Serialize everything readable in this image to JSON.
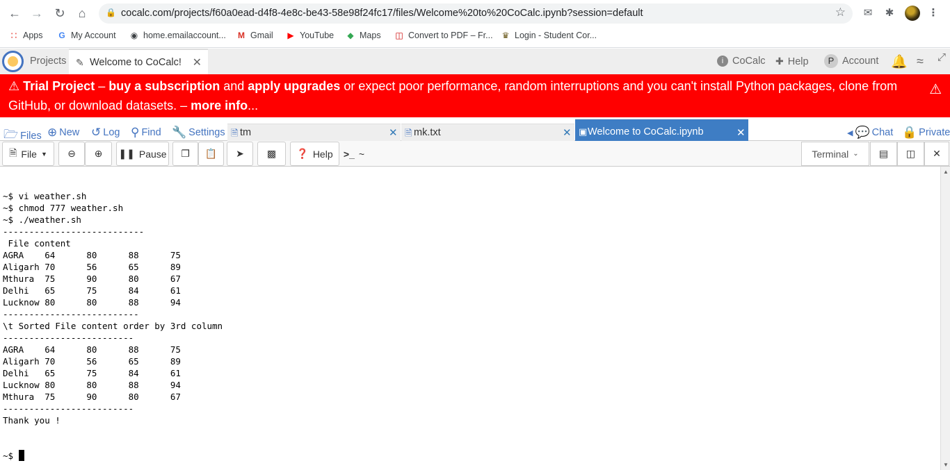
{
  "browser": {
    "url": "cocalc.com/projects/f60a0ead-d4f8-4e8c-be43-58e98f24fc17/files/Welcome%20to%20CoCalc.ipynb?session=default",
    "bookmarks": [
      {
        "label": "Apps",
        "icon": "apps-grid-icon"
      },
      {
        "label": "My Account",
        "icon": "google-icon"
      },
      {
        "label": "home.emailaccount...",
        "icon": "globe-icon"
      },
      {
        "label": "Gmail",
        "icon": "gmail-icon"
      },
      {
        "label": "YouTube",
        "icon": "youtube-icon"
      },
      {
        "label": "Maps",
        "icon": "maps-icon"
      },
      {
        "label": "Convert to PDF – Fr...",
        "icon": "pdf-icon"
      },
      {
        "label": "Login - Student Cor...",
        "icon": "student-icon"
      }
    ]
  },
  "cocalc_nav": {
    "projects": "Projects",
    "active_tab": "Welcome to CoCalc!",
    "cocalc": "CoCalc",
    "help": "Help",
    "account": "Account",
    "account_initial": "P"
  },
  "banner": {
    "part1": "Trial Project",
    "part2": " – ",
    "part3": "buy a subscription",
    "part4": " and ",
    "part5": "apply upgrades",
    "part6": " or expect poor performance, random interruptions and you can't install Python packages, clone from GitHub, or download datasets. – ",
    "part7": "more info",
    "part8": "..."
  },
  "file_tools": {
    "files": "Files",
    "new": "New",
    "log": "Log",
    "find": "Find",
    "settings": "Settings",
    "chat": "Chat",
    "private": "Private"
  },
  "file_tabs": [
    {
      "label": "tm",
      "active": false
    },
    {
      "label": "mk.txt",
      "active": false
    },
    {
      "label": "Welcome to CoCalc.ipynb",
      "active": true
    }
  ],
  "toolbar": {
    "file": "File",
    "pause": "Pause",
    "help": "Help",
    "term_prompt": "~",
    "terminal": "Terminal"
  },
  "terminal_lines": [
    "~$ vi weather.sh",
    "~$ chmod 777 weather.sh",
    "~$ ./weather.sh",
    "---------------------------",
    " File content",
    "AGRA    64      80      88      75",
    "Aligarh 70      56      65      89",
    "Mthura  75      90      80      67",
    "Delhi   65      75      84      61",
    "Lucknow 80      80      88      94",
    "--------------------------",
    "\\t Sorted File content order by 3rd column",
    "-------------------------",
    "AGRA    64      80      88      75",
    "Aligarh 70      56      65      89",
    "Delhi   65      75      84      61",
    "Lucknow 80      80      88      94",
    "Mthura  75      90      80      67",
    "-------------------------",
    "Thank you !"
  ],
  "terminal_prompt": "~$ "
}
